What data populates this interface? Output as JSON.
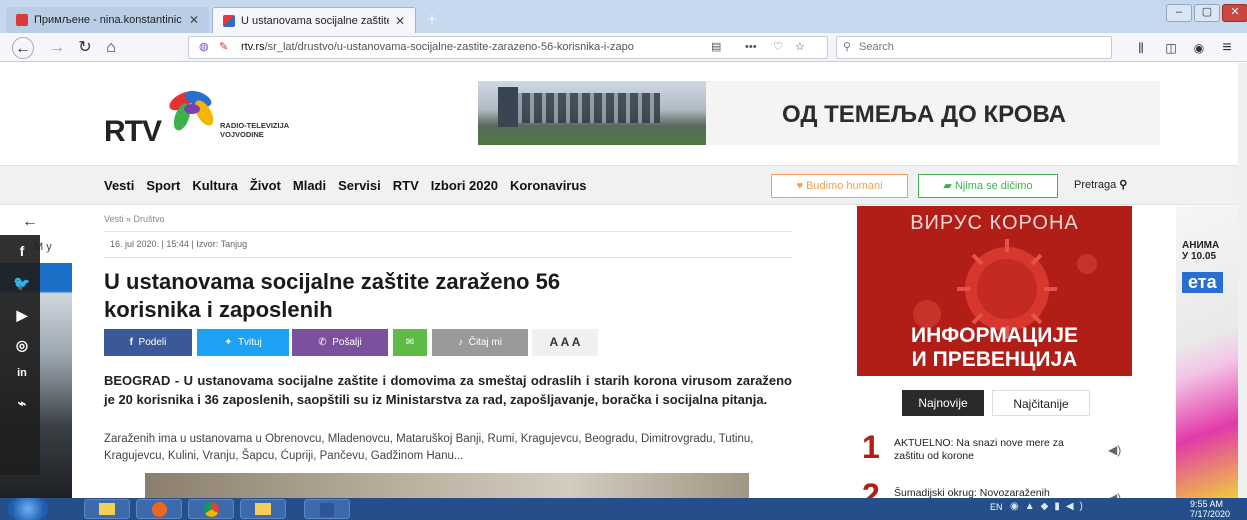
{
  "browser": {
    "tabs": [
      {
        "title": "Примљене - nina.konstantinic",
        "active": false
      },
      {
        "title": "U ustanovama socijalne zaštite",
        "active": true
      }
    ],
    "url_prefix": "rtv.rs",
    "url_rest": "/sr_lat/drustvo/u-ustanovama-socijalne-zastite-zarazeno-56-korisnika-i-zapo",
    "search_placeholder": "Search"
  },
  "header": {
    "logo_text": "RTV",
    "logo_sub1": "RADIO-TELEVIZIJA",
    "logo_sub2": "VOJVODINE",
    "banner_text": "ОД ТЕМЕЉА ДО КРОВА"
  },
  "menu": {
    "items": [
      "Vesti",
      "Sport",
      "Kultura",
      "Život",
      "Mladi",
      "Servisi",
      "RTV",
      "Izbori 2020",
      "Koronavirus"
    ],
    "budimo_humani": "Budimo humani",
    "njima_se_dicimo": "Njima se dičimo",
    "pretraga": "Pretraga"
  },
  "article": {
    "breadcrumb": "Vesti » Društvo",
    "meta": "16. jul 2020. | 15:44 | Izvor: Tanjug",
    "headline_line1": "U ustanovama socijalne zaštite zaraženo 56",
    "headline_line2": "korisnika i zaposlenih",
    "share": {
      "podeli": "Podeli",
      "tvituj": "Tvituj",
      "posalji": "Pošalji",
      "citaj": "Čitaj mi",
      "font_sizes": "A A A"
    },
    "lead": "BEOGRAD - U ustanovama socijalne zaštite i domovima za smeštaj odraslih i starih korona virusom zaraženo je 20 korisnika i 36 zaposlenih, saopštili su iz Ministarstva za rad, zapošljavanje, boračka i socijalna pitanja.",
    "body": "Zaraženih ima u ustanovama u Obrenovcu, Mladenovcu, Mataruškoj Banji, Rumi, Kragujevcu, Beogradu, Dimitrovgradu, Tutinu, Kragujevcu, Kulini, Vranju, Šapcu, Ćupriji, Pančevu, Gadžinom Hanu..."
  },
  "sidebar": {
    "ad_top": "ВИРУС КОРОНА",
    "ad_bottom1": "ИНФОРМАЦИЈЕ",
    "ad_bottom2": "И ПРЕВЕНЦИЈА",
    "tab_najnovije": "Najnovije",
    "tab_najcitanije": "Najčitanije",
    "news": [
      {
        "num": "1",
        "text": "AKTUELNO: Na snazi nove mere za zaštitu od korone"
      },
      {
        "num": "2",
        "text": "Šumadijski okrug: Novozaraženih"
      }
    ]
  },
  "side_partials": {
    "left_top": "M y",
    "right_top1": "АНИМА",
    "right_top2": "У 10.05",
    "right_mid": "ета"
  },
  "taskbar": {
    "lang": "EN",
    "time": "9:55 AM",
    "date": "7/17/2020"
  },
  "colors": {
    "accent": "#b01e17",
    "facebook": "#3b5998",
    "twitter": "#1da1f2",
    "viber": "#7b519d",
    "email": "#5dbb46",
    "listen": "#9a9a9a"
  }
}
